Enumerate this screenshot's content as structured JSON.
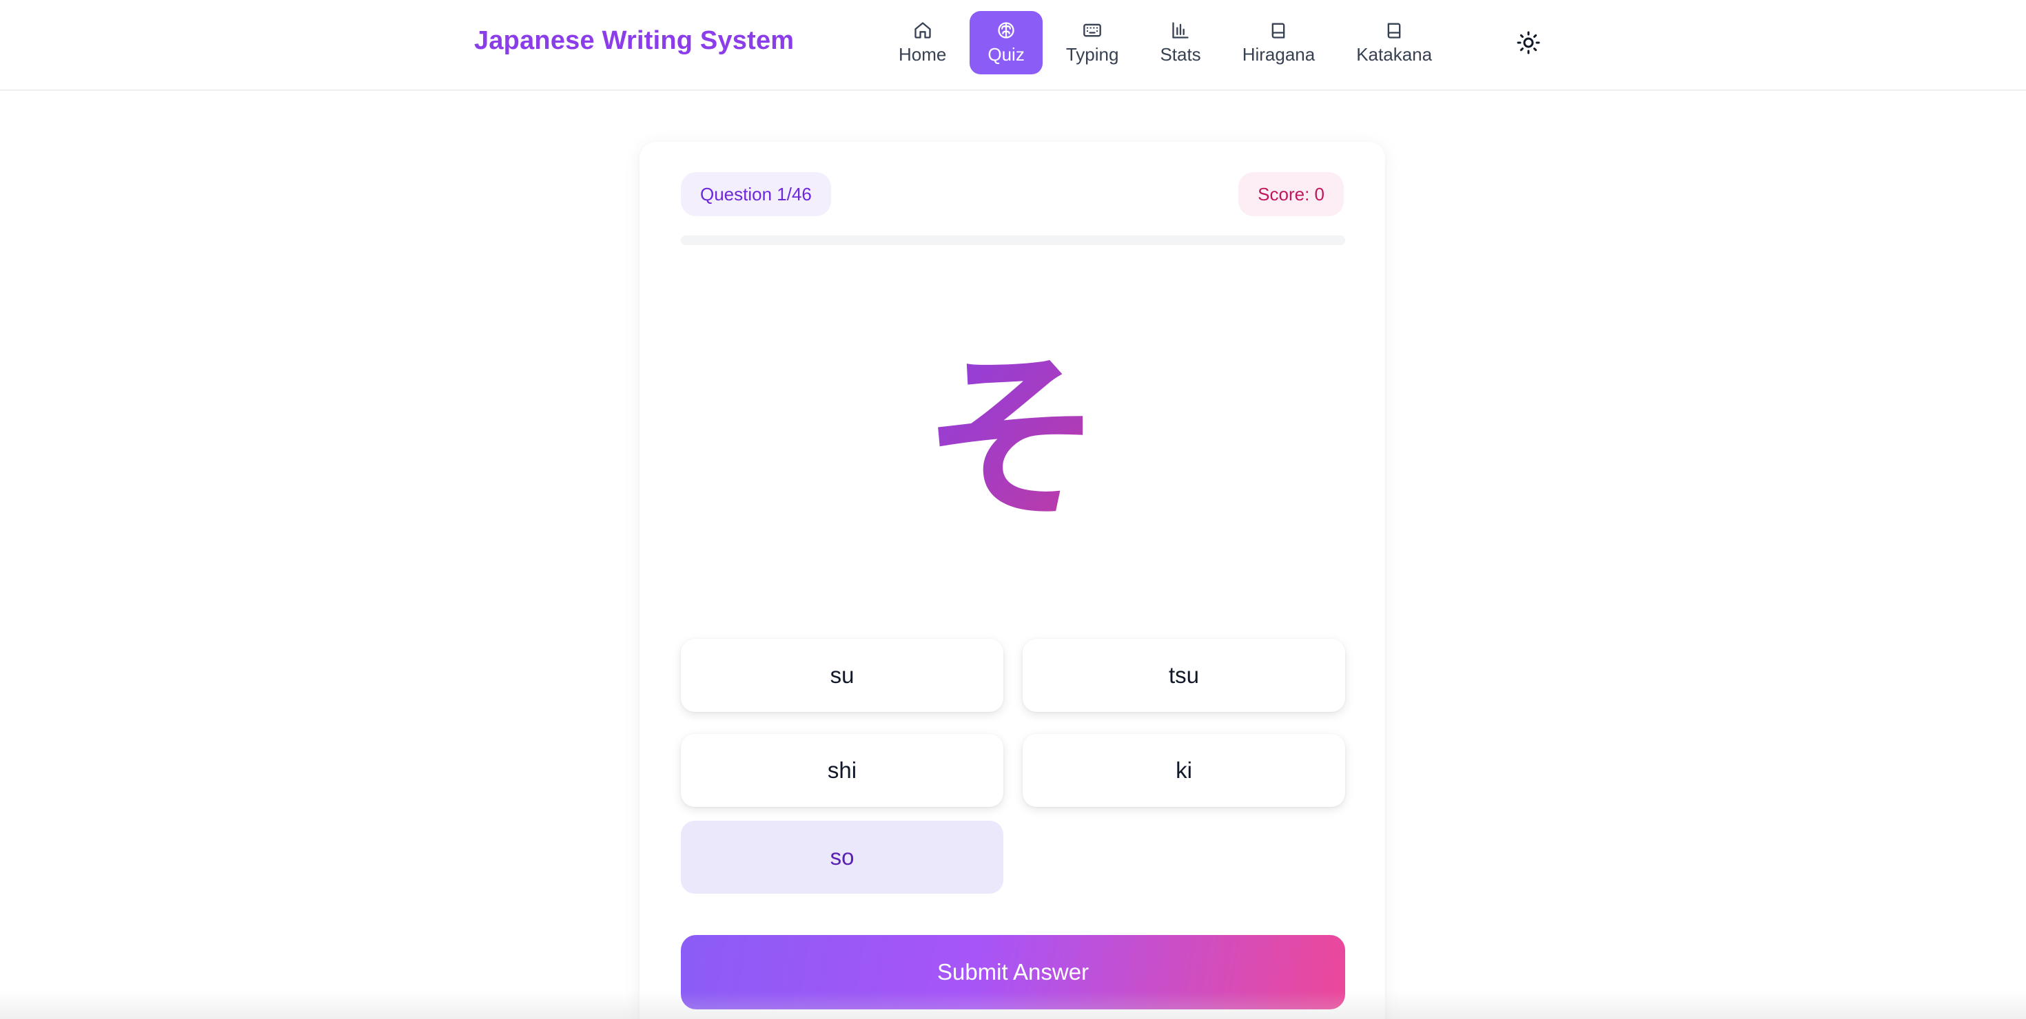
{
  "app": {
    "title": "Japanese Writing System"
  },
  "nav": {
    "items": [
      {
        "label": "Home",
        "icon": "home-icon",
        "active": false
      },
      {
        "label": "Quiz",
        "icon": "brain-icon",
        "active": true
      },
      {
        "label": "Typing",
        "icon": "keyboard-icon",
        "active": false
      },
      {
        "label": "Stats",
        "icon": "bar-chart-icon",
        "active": false
      },
      {
        "label": "Hiragana",
        "icon": "book-icon",
        "active": false
      },
      {
        "label": "Katakana",
        "icon": "book-icon",
        "active": false
      }
    ],
    "theme_toggle_icon": "sun-icon"
  },
  "quiz": {
    "question_label": "Question 1/46",
    "score_label": "Score: 0",
    "progress_fraction": 0.0,
    "character": "そ",
    "options": [
      "su",
      "tsu",
      "shi",
      "ki",
      "so"
    ],
    "selected_option": "so",
    "submit_label": "Submit Answer"
  },
  "colors": {
    "brand": "#8b3dea",
    "accent": "#8b5cf6",
    "pink": "#ec4899",
    "selected_option_bg": "#ece8fb"
  }
}
